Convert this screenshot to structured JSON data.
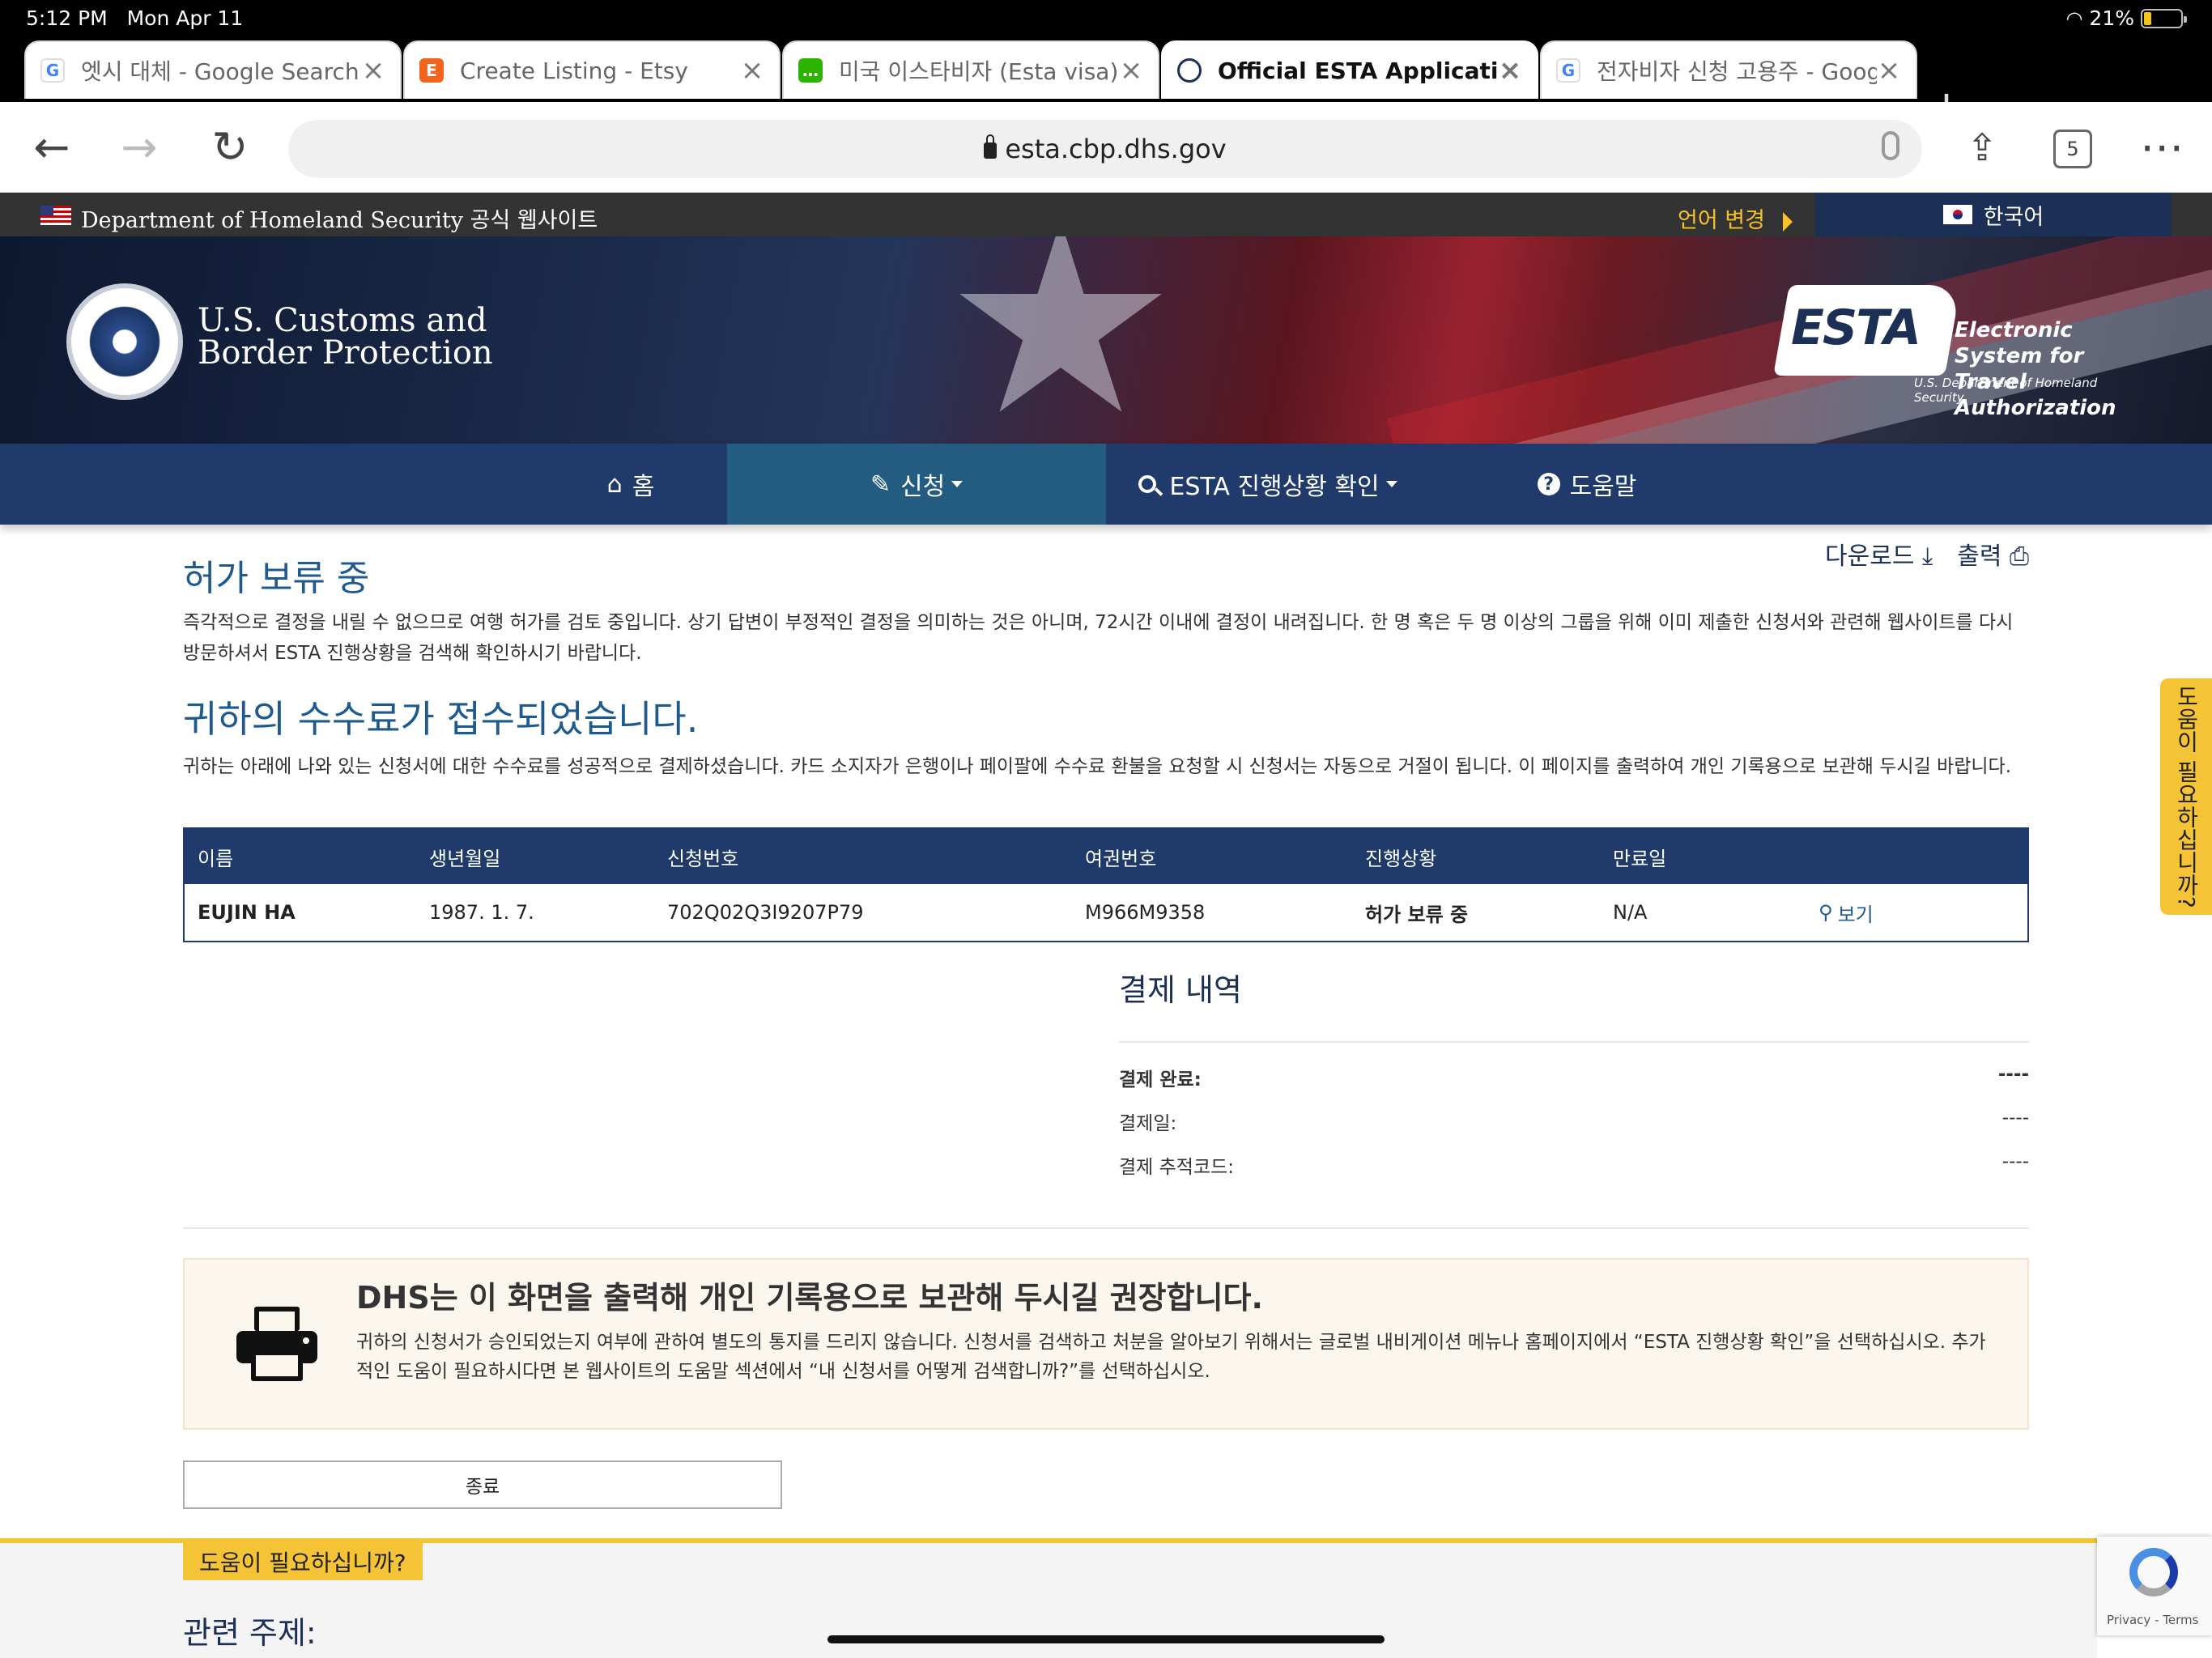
{
  "status_bar": {
    "time": "5:12 PM",
    "date": "Mon Apr 11",
    "battery": "21%",
    "battery_level": 0.21
  },
  "tabs": [
    {
      "label": "엣시 대체 - Google Search",
      "favicon": "G",
      "favicon_color": "#4285f4",
      "active": false
    },
    {
      "label": "Create Listing - Etsy",
      "favicon": "E",
      "favicon_color": "#f1641e",
      "active": false
    },
    {
      "label": "미국 이스타비자 (Esta visa)",
      "favicon": "…",
      "favicon_color": "#2db400",
      "active": false
    },
    {
      "label": "Official ESTA Application",
      "favicon": "seal",
      "favicon_color": "#1c2f55",
      "active": true
    },
    {
      "label": "전자비자 신청 고용주 - Goog",
      "favicon": "G",
      "favicon_color": "#4285f4",
      "active": false
    }
  ],
  "toolbar": {
    "url": "esta.cbp.dhs.gov",
    "tab_count": "5"
  },
  "gov_banner": {
    "text": "Department of Homeland Security 공식 웹사이트",
    "language_change": "언어 변경",
    "current_language": "한국어"
  },
  "header": {
    "agency_line1": "U.S. Customs and",
    "agency_line2": "Border Protection",
    "esta_logo": "ESTA",
    "esta_tagline1": "Electronic System for",
    "esta_tagline2": "Travel Authorization",
    "esta_sub": "U.S. Department of Homeland Security"
  },
  "nav": {
    "home": "홈",
    "apply": "신청",
    "status": "ESTA 진행상황 확인",
    "help": "도움말"
  },
  "actions": {
    "download": "다운로드",
    "print": "출력"
  },
  "pending": {
    "title": "허가 보류 중",
    "text": "즉각적으로 결정을 내릴 수 없으므로 여행 허가를 검토 중입니다. 상기 답변이 부정적인 결정을 의미하는 것은 아니며, 72시간 이내에 결정이 내려집니다. 한 명 혹은 두 명 이상의 그룹을 위해 이미 제출한 신청서와 관련해 웹사이트를 다시 방문하셔서 ESTA 진행상황을 검색해 확인하시기 바랍니다."
  },
  "fee": {
    "title": "귀하의 수수료가 접수되었습니다.",
    "text": "귀하는 아래에 나와 있는 신청서에 대한 수수료를 성공적으로 결제하셨습니다. 카드 소지자가 은행이나 페이팔에 수수료 환불을 요청할 시 신청서는 자동으로 거절이 됩니다. 이 페이지를 출력하여 개인 기록용으로 보관해 두시길 바랍니다."
  },
  "table": {
    "headers": [
      "이름",
      "생년월일",
      "신청번호",
      "여권번호",
      "진행상황",
      "만료일"
    ],
    "rows": [
      {
        "name": "EUJIN HA",
        "dob": "1987. 1. 7.",
        "app_no": "702Q02Q3I9207P79",
        "passport": "M966M9358",
        "status": "허가 보류 중",
        "expiry": "N/A",
        "view": "보기"
      }
    ]
  },
  "payment": {
    "title": "결제 내역",
    "rows": [
      {
        "label": "결제 완료:",
        "value": "----"
      },
      {
        "label": "결제일:",
        "value": "----"
      },
      {
        "label": "결제 추적코드:",
        "value": "----"
      }
    ]
  },
  "notice": {
    "title": "DHS는 이 화면을 출력해 개인 기록용으로 보관해 두시길 권장합니다.",
    "text": "귀하의 신청서가 승인되었는지 여부에 관하여 별도의 통지를 드리지 않습니다. 신청서를 검색하고 처분을 알아보기 위해서는 글로벌 내비게이션 메뉴나 홈페이지에서 “ESTA 진행상황 확인”을 선택하십시오. 추가적인 도움이 필요하시다면 본 웹사이트의 도움말 섹션에서 “내 신청서를 어떻게 검색합니까?”를 선택하십시오."
  },
  "close_button": "종료",
  "footer": {
    "help_tag": "도움이 필요하십니까?",
    "related": "관련 주제:",
    "side_help": "도움이 필요하십니까?"
  },
  "recaptcha": {
    "text": "Privacy - Terms"
  },
  "colors": {
    "navy": "#1f3a6b",
    "active_nav": "#235c80",
    "heading_blue": "#1e5a8e",
    "accent_yellow": "#f5c436"
  }
}
